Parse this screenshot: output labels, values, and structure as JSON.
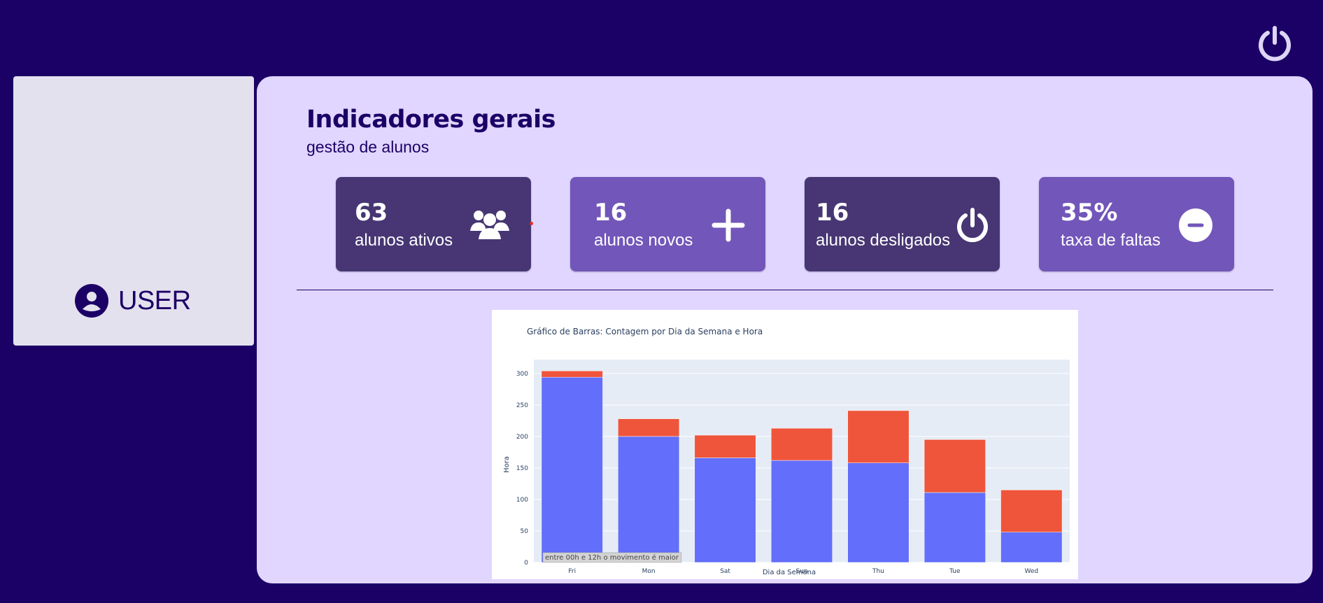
{
  "header": {
    "logout_icon": "power-icon"
  },
  "sidebar": {
    "user_label": "USER",
    "user_icon": "user-circle-icon"
  },
  "main": {
    "title": "Indicadores gerais",
    "subtitle": "gestão de alunos",
    "cards": [
      {
        "value": "63",
        "label": "alunos ativos",
        "icon": "users-icon"
      },
      {
        "value": "16",
        "label": "alunos novos",
        "icon": "plus-icon"
      },
      {
        "value": "16",
        "label": "alunos desligados",
        "icon": "power-icon"
      },
      {
        "value": "35%",
        "label": "taxa de faltas",
        "icon": "minus-circle-icon"
      }
    ]
  },
  "colors": {
    "background": "#1b0066",
    "panel": "#e0d6ff",
    "card_dark": "#473673",
    "card_light": "#7256b9",
    "series_1": "#636efa",
    "series_2": "#ef553b"
  },
  "chart_data": {
    "type": "bar",
    "stacked": true,
    "title": "Gráfico de Barras: Contagem por Dia da Semana e Hora",
    "xlabel": "Dia da Semana",
    "ylabel": "Hora",
    "categories": [
      "Fri",
      "Mon",
      "Sat",
      "Sun",
      "Thu",
      "Tue",
      "Wed"
    ],
    "series": [
      {
        "color": "#636efa",
        "values": [
          294,
          200,
          166,
          162,
          158,
          111,
          48
        ]
      },
      {
        "color": "#ef553b",
        "values": [
          10,
          28,
          36,
          51,
          83,
          84,
          67
        ]
      }
    ],
    "ylim": [
      0,
      322
    ],
    "yticks": [
      0,
      50,
      100,
      150,
      200,
      250,
      300
    ],
    "grid": true,
    "annotation": "entre 00h e 12h o movimento é maior"
  }
}
